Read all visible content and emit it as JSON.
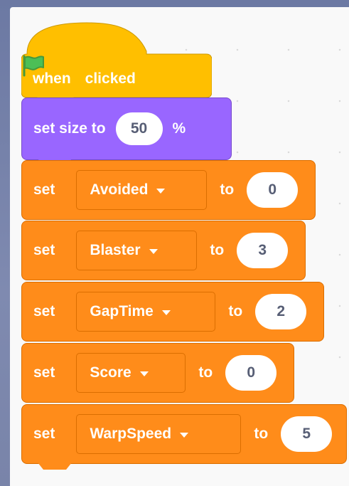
{
  "blocks": {
    "hat": {
      "when": "when",
      "clicked": "clicked",
      "color": "#ffbf00",
      "icon": "green-flag-icon"
    },
    "looks": {
      "label": "set size to",
      "value": "50",
      "unit": "%",
      "color": "#9966ff"
    },
    "variables": [
      {
        "set": "set",
        "variable": "Avoided",
        "to": "to",
        "value": "0"
      },
      {
        "set": "set",
        "variable": "Blaster",
        "to": "to",
        "value": "3"
      },
      {
        "set": "set",
        "variable": "GapTime",
        "to": "to",
        "value": "2"
      },
      {
        "set": "set",
        "variable": "Score",
        "to": "to",
        "value": "0"
      },
      {
        "set": "set",
        "variable": "WarpSpeed",
        "to": "to",
        "value": "5"
      }
    ],
    "variable_color": "#ff8c1a"
  }
}
